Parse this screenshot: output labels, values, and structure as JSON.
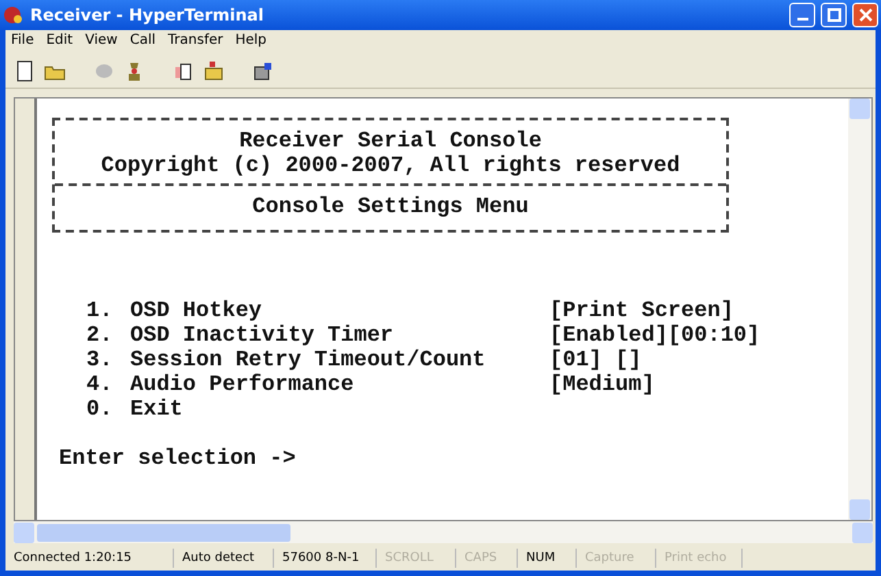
{
  "window": {
    "title": "Receiver - HyperTerminal"
  },
  "menu": [
    "File",
    "Edit",
    "View",
    "Call",
    "Transfer",
    "Help"
  ],
  "terminal": {
    "header": [
      "Receiver Serial Console",
      "Copyright (c) 2000-2007, All rights reserved"
    ],
    "section_title": "Console Settings Menu",
    "items": [
      {
        "number": "1.",
        "label": "OSD Hotkey",
        "value": "[Print Screen]"
      },
      {
        "number": "2.",
        "label": "OSD Inactivity Timer",
        "value": "[Enabled][00:10]"
      },
      {
        "number": "3.",
        "label": "Session Retry Timeout/Count",
        "value": "[01] []"
      },
      {
        "number": "4.",
        "label": "Audio Performance",
        "value": "[Medium]"
      },
      {
        "number": "0.",
        "label": "Exit"
      }
    ],
    "prompt": "Enter selection ->"
  },
  "status_bar": [
    {
      "text": "Connected 1:20:15",
      "disabled": false
    },
    {
      "text": "Auto detect",
      "disabled": false
    },
    {
      "text": "57600 8-N-1",
      "disabled": false
    },
    {
      "text": "SCROLL",
      "disabled": true
    },
    {
      "text": "CAPS",
      "disabled": true
    },
    {
      "text": "NUM",
      "disabled": false
    },
    {
      "text": "Capture",
      "disabled": true
    },
    {
      "text": "Print echo",
      "disabled": true
    }
  ]
}
